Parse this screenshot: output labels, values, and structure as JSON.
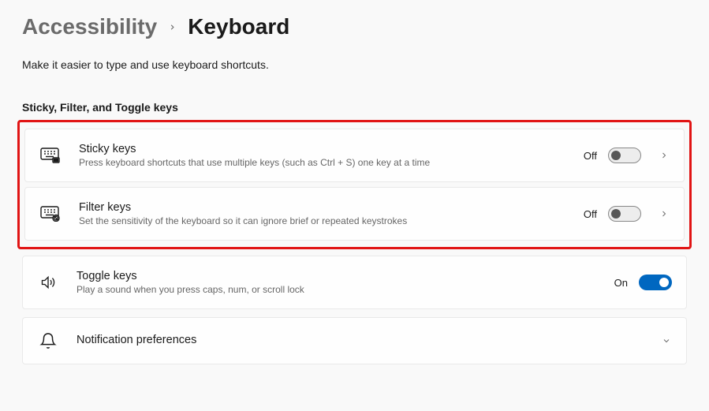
{
  "breadcrumb": {
    "parent": "Accessibility",
    "current": "Keyboard"
  },
  "subtitle": "Make it easier to type and use keyboard shortcuts.",
  "section1_title": "Sticky, Filter, and Toggle keys",
  "rows": {
    "sticky": {
      "title": "Sticky keys",
      "desc": "Press keyboard shortcuts that use multiple keys (such as Ctrl + S) one key at a time",
      "state_label": "Off"
    },
    "filter": {
      "title": "Filter keys",
      "desc": "Set the sensitivity of the keyboard so it can ignore brief or repeated keystrokes",
      "state_label": "Off"
    },
    "toggle": {
      "title": "Toggle keys",
      "desc": "Play a sound when you press caps, num, or scroll lock",
      "state_label": "On"
    },
    "notif": {
      "title": "Notification preferences"
    }
  }
}
